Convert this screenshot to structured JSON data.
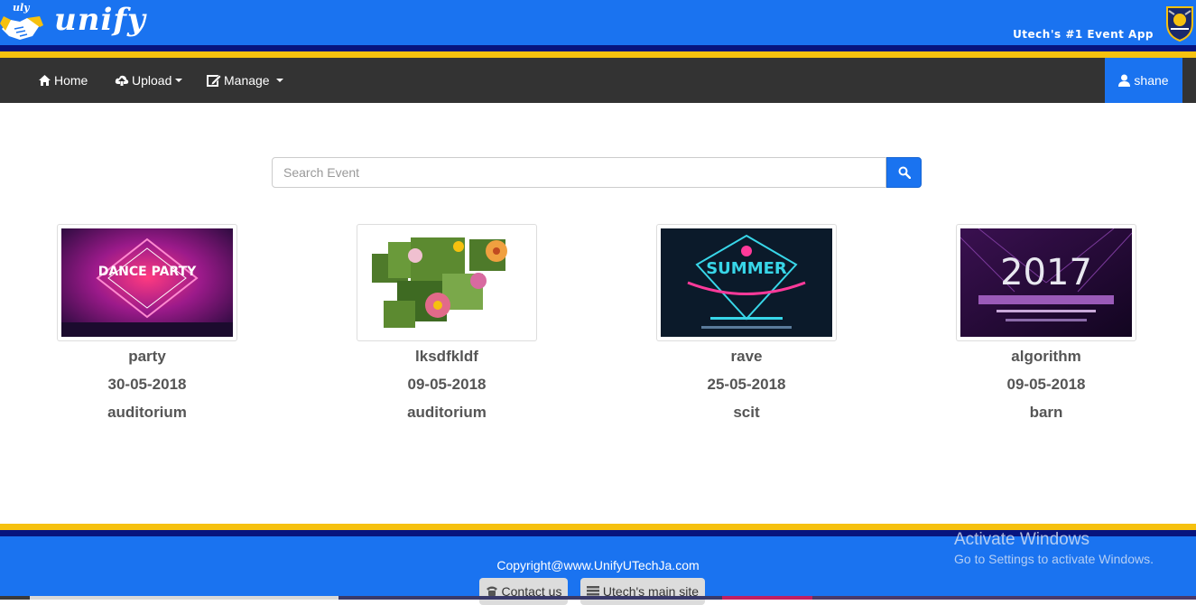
{
  "header": {
    "logo_small": "uly",
    "logo_text": "unify",
    "tagline": "Utech's #1 Event App"
  },
  "nav": {
    "home": "Home",
    "upload": "Upload",
    "manage": "Manage",
    "user": "shane"
  },
  "search": {
    "placeholder": "Search Event"
  },
  "events": [
    {
      "name": "party",
      "date": "30-05-2018",
      "venue": "auditorium",
      "poster_text": "DANCE PARTY"
    },
    {
      "name": "lksdfkldf",
      "date": "09-05-2018",
      "venue": "auditorium",
      "poster_text": ""
    },
    {
      "name": "rave",
      "date": "25-05-2018",
      "venue": "scit",
      "poster_text": "SUMMER"
    },
    {
      "name": "algorithm",
      "date": "09-05-2018",
      "venue": "barn",
      "poster_text": "2017"
    }
  ],
  "footer": {
    "copyright": "Copyright@www.UnifyUTechJa.com",
    "contact": "Contact us",
    "main_site": "Utech's main site"
  },
  "watermark": {
    "title": "Activate Windows",
    "subtitle": "Go to Settings to activate Windows."
  },
  "colors": {
    "brand_blue": "#1a73f0",
    "navy": "#07147e",
    "gold": "#f6c10f",
    "navbar": "#333333"
  }
}
